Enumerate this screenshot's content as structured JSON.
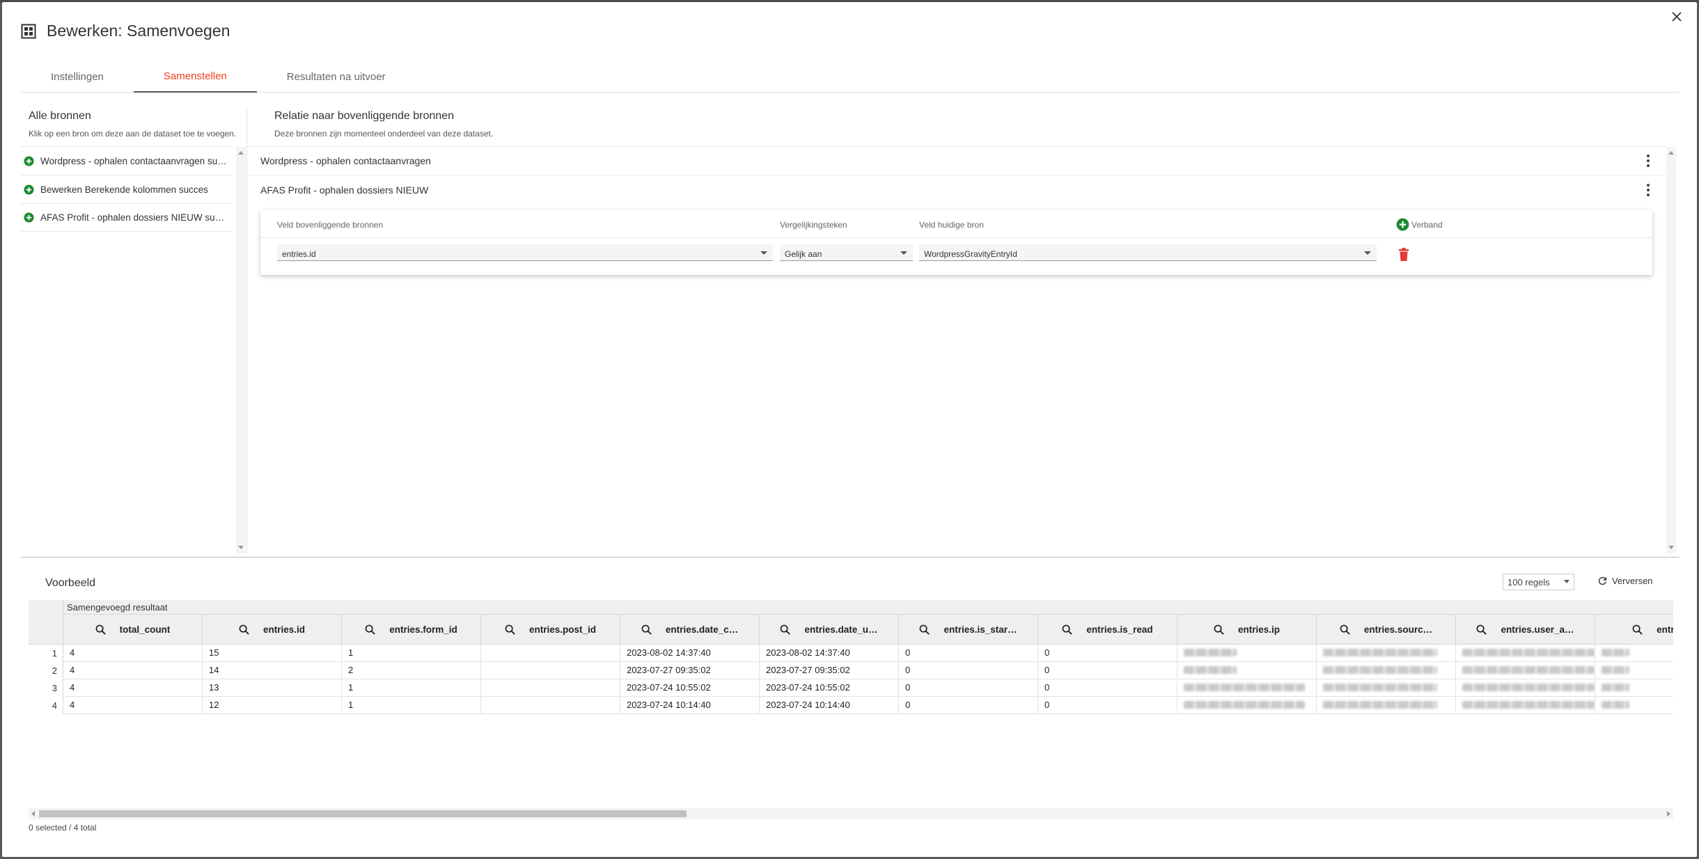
{
  "dialog": {
    "title": "Bewerken: Samenvoegen",
    "icons": {
      "title": "grid-dashboard-icon",
      "close": "close-icon"
    }
  },
  "tabs": [
    {
      "label": "Instellingen",
      "active": false
    },
    {
      "label": "Samenstellen",
      "active": true
    },
    {
      "label": "Resultaten na uitvoer",
      "active": false
    }
  ],
  "left_panel": {
    "title": "Alle bronnen",
    "subtitle": "Klik op een bron om deze aan de dataset toe te voegen.",
    "sources": [
      {
        "label": "Wordpress - ophalen contactaanvragen succes"
      },
      {
        "label": "Bewerken Berekende kolommen succes"
      },
      {
        "label": "AFAS Profit - ophalen dossiers NIEUW succes"
      }
    ]
  },
  "right_panel": {
    "title": "Relatie naar bovenliggende bronnen",
    "subtitle": "Deze bronnen zijn momenteel onderdeel van deze dataset.",
    "sources": [
      {
        "label": "Wordpress - ophalen contactaanvragen"
      },
      {
        "label": "AFAS Profit - ophalen dossiers NIEUW"
      }
    ],
    "join": {
      "headers": {
        "parent_field": "Veld bovenliggende bronnen",
        "operator": "Vergelijkingsteken",
        "current_field": "Veld huidige bron",
        "add": "Verband"
      },
      "row": {
        "parent_field": "entries.id",
        "operator": "Gelijk aan",
        "current_field": "WordpressGravityEntryId"
      }
    }
  },
  "preview": {
    "title": "Voorbeeld",
    "rows_select": "100 regels",
    "refresh_label": "Verversen",
    "group_label": "Samengevoegd resultaat",
    "columns": [
      "total_count",
      "entries.id",
      "entries.form_id",
      "entries.post_id",
      "entries.date_c…",
      "entries.date_u…",
      "entries.is_star…",
      "entries.is_read",
      "entries.ip",
      "entries.sourc…",
      "entries.user_a…",
      "entries…"
    ],
    "rows": [
      [
        "1",
        "4",
        "15",
        "1",
        "",
        "2023-08-02 14:37:40",
        "2023-08-02 14:37:40",
        "0",
        "0"
      ],
      [
        "2",
        "4",
        "14",
        "2",
        "",
        "2023-07-27 09:35:02",
        "2023-07-27 09:35:02",
        "0",
        "0"
      ],
      [
        "3",
        "4",
        "13",
        "1",
        "",
        "2023-07-24 10:55:02",
        "2023-07-24 10:55:02",
        "0",
        "0"
      ],
      [
        "4",
        "4",
        "12",
        "1",
        "",
        "2023-07-24 10:14:40",
        "2023-07-24 10:14:40",
        "0",
        "0"
      ]
    ],
    "status": "0 selected / 4 total"
  },
  "colors": {
    "accent": "#f0401e",
    "add_green": "#1a8a2e",
    "delete_red": "#e53935"
  }
}
